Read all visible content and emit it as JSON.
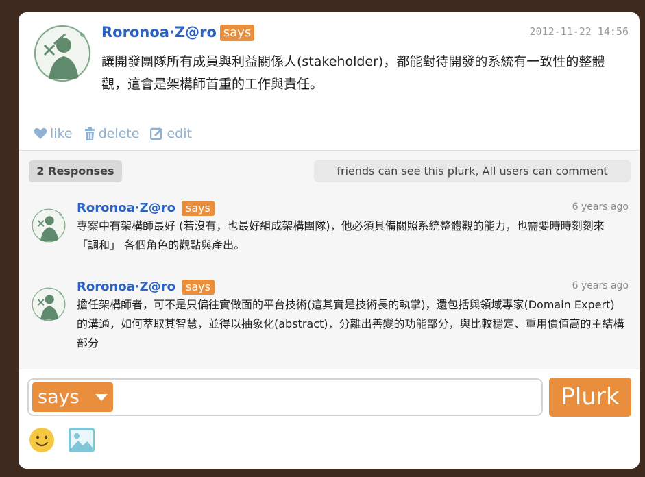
{
  "post": {
    "author": "Roronoa·Z@ro",
    "qualifier": "says",
    "timestamp": "2012-11-22 14:56",
    "content": "讓開發團隊所有成員與利益關係人(stakeholder)，都能對待開發的系統有一致性的整體觀，這會是架構師首重的工作與責任。",
    "actions": {
      "like": "like",
      "delete": "delete",
      "edit": "edit"
    }
  },
  "responses_header": {
    "count_label": "2 Responses",
    "permission_text": "friends can see this plurk, All users can comment"
  },
  "responses": [
    {
      "author": "Roronoa·Z@ro",
      "qualifier": "says",
      "time": "6 years ago",
      "content": "專案中有架構師最好 (若沒有，也最好組成架構團隊)，他必須具備關照系統整體觀的能力，也需要時時刻刻來 「調和」 各個角色的觀點與產出。"
    },
    {
      "author": "Roronoa·Z@ro",
      "qualifier": "says",
      "time": "6 years ago",
      "content": "擔任架構師者，可不是只偏往實做面的平台技術(這其實是技術長的執掌)，還包括與領域專家(Domain Expert)的溝通，如何萃取其智慧，並得以抽象化(abstract)，分離出善變的功能部分，與比較穩定、重用價值高的主結構部分"
    }
  ],
  "composer": {
    "qualifier": "says",
    "input_value": "",
    "submit_label": "Plurk"
  },
  "icons": {
    "like": "heart-icon",
    "delete": "trash-icon",
    "edit": "edit-icon",
    "emoji": "smiley-icon",
    "image": "image-icon"
  },
  "colors": {
    "background": "#3e2a1e",
    "accent": "#e98e3c",
    "name": "#2b63c4",
    "action": "#8fb2d4"
  }
}
